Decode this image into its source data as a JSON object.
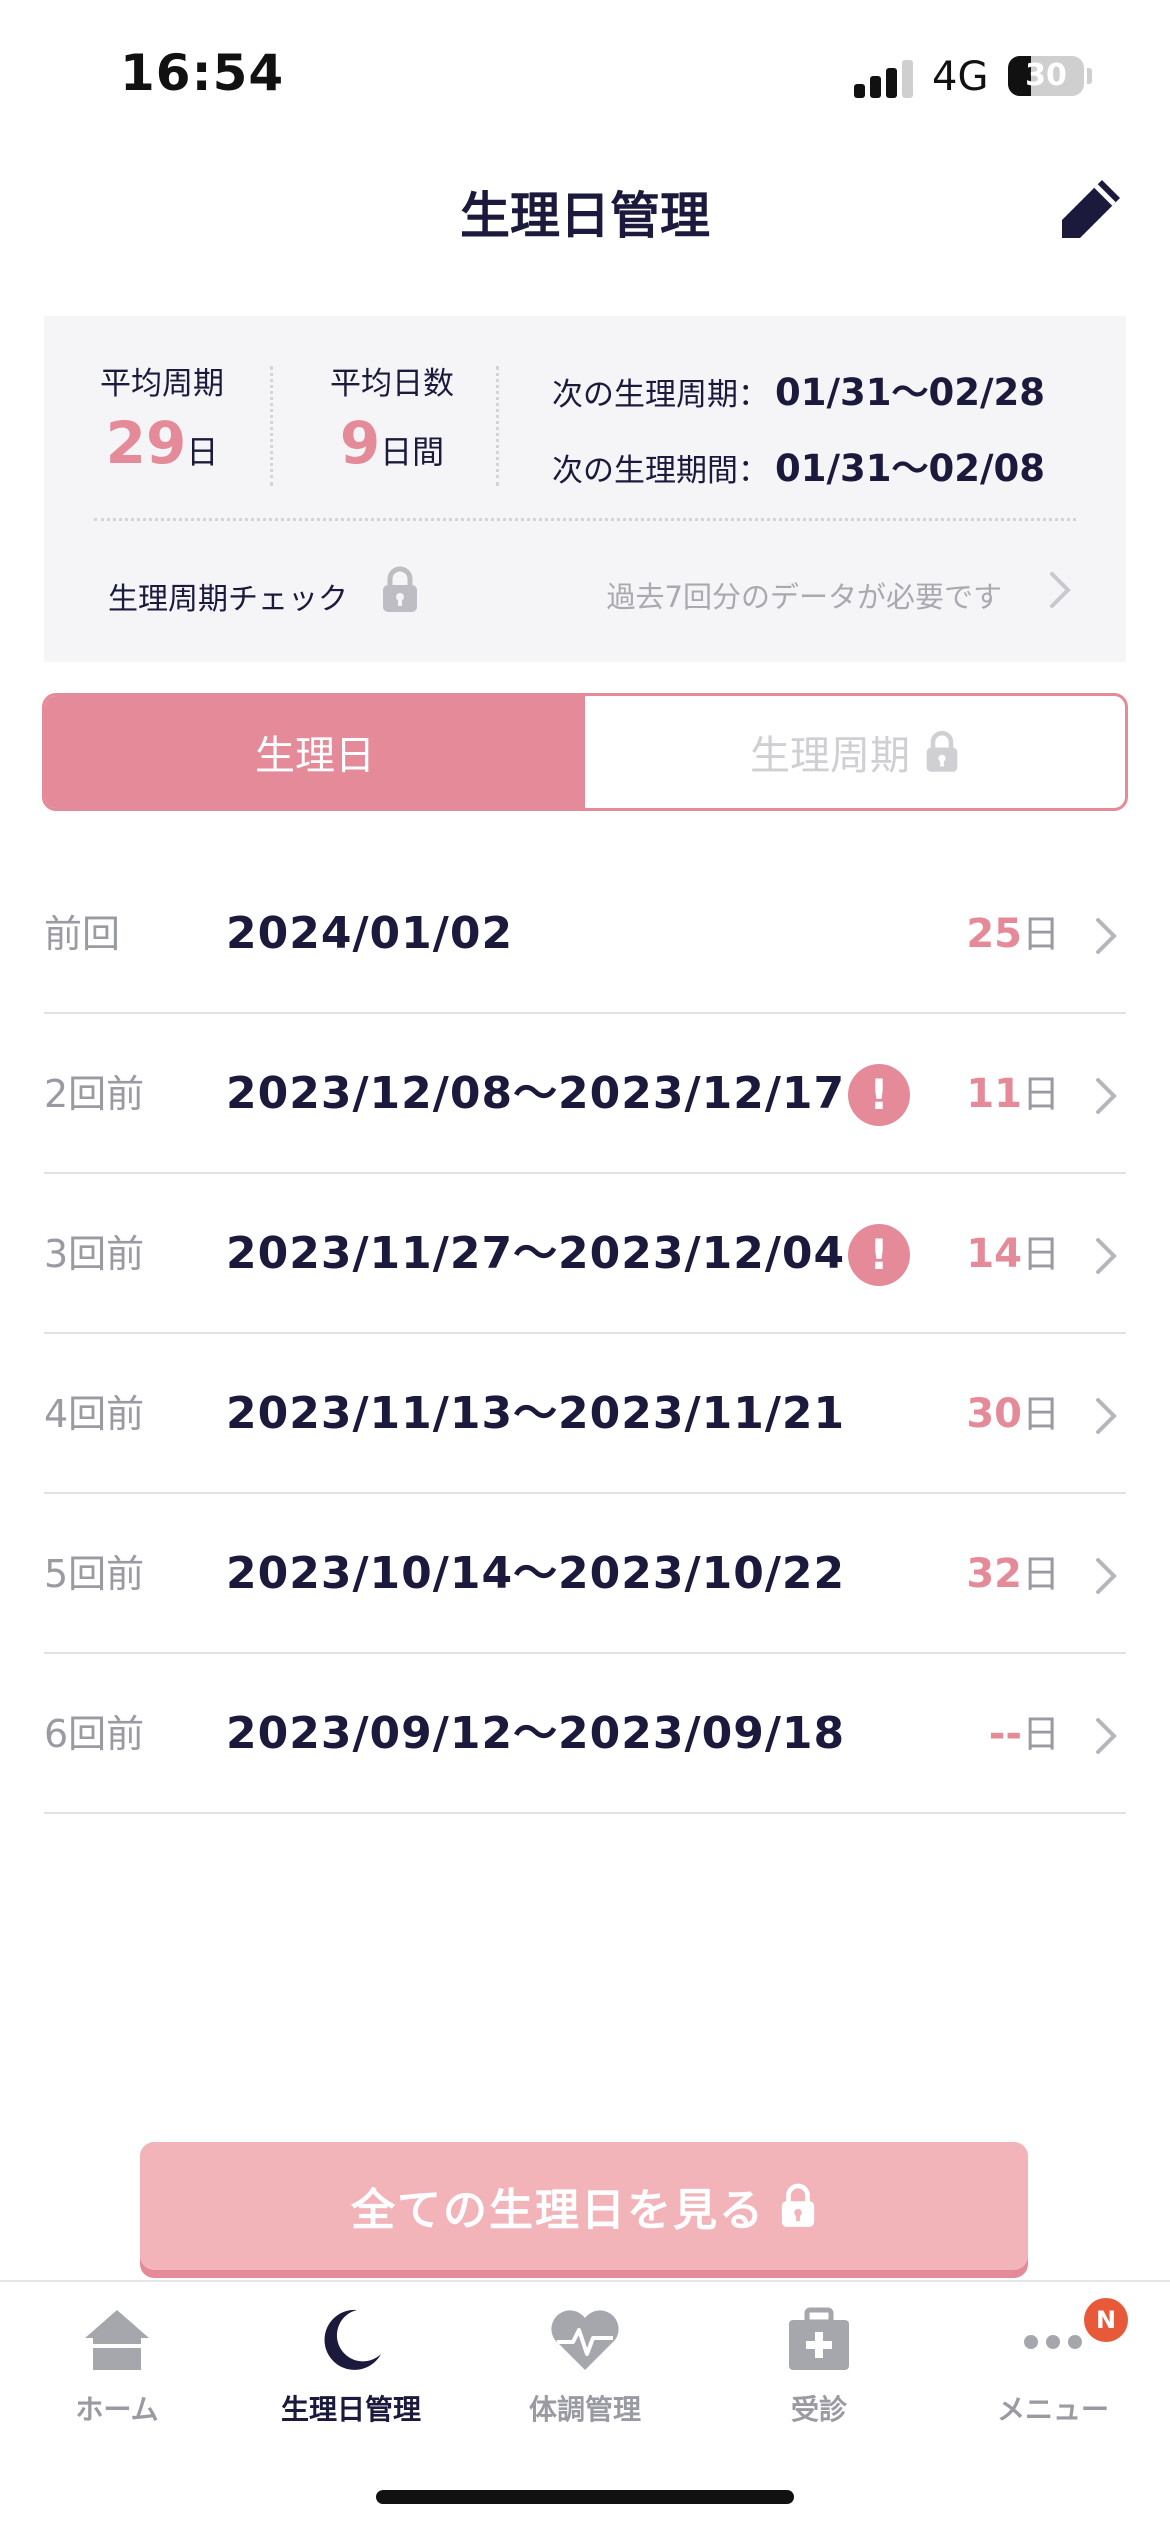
{
  "status_bar": {
    "time": "16:54",
    "network": "4G",
    "battery": "30",
    "battery_level_percent": 30
  },
  "header": {
    "title": "生理日管理",
    "edit_icon": "pencil-icon"
  },
  "summary": {
    "avg_cycle": {
      "label": "平均周期",
      "value": "29",
      "unit": "日"
    },
    "avg_days": {
      "label": "平均日数",
      "value": "9",
      "unit": "日間"
    },
    "next_cycle": {
      "label": "次の生理周期：",
      "value": "01/31〜02/28"
    },
    "next_period": {
      "label": "次の生理期間：",
      "value": "01/31〜02/08"
    },
    "cycle_check": {
      "label": "生理周期チェック",
      "message": "過去7回分のデータが必要です",
      "locked": true
    }
  },
  "tabs": {
    "period": "生理日",
    "cycle": "生理周期",
    "cycle_locked": true
  },
  "history": [
    {
      "label": "前回",
      "date": "2024/01/02",
      "days": "25",
      "unit": "日",
      "alert": false
    },
    {
      "label": "2回前",
      "date": "2023/12/08〜2023/12/17",
      "days": "11",
      "unit": "日",
      "alert": true
    },
    {
      "label": "3回前",
      "date": "2023/11/27〜2023/12/04",
      "days": "14",
      "unit": "日",
      "alert": true
    },
    {
      "label": "4回前",
      "date": "2023/11/13〜2023/11/21",
      "days": "30",
      "unit": "日",
      "alert": false
    },
    {
      "label": "5回前",
      "date": "2023/10/14〜2023/10/22",
      "days": "32",
      "unit": "日",
      "alert": false
    },
    {
      "label": "6回前",
      "date": "2023/09/12〜2023/09/18",
      "days": "--",
      "unit": "日",
      "alert": false
    }
  ],
  "cta": {
    "all_periods": "全ての生理日を見る"
  },
  "tab_bar": {
    "items": [
      {
        "label": "ホーム",
        "icon": "home-icon",
        "active": false
      },
      {
        "label": "生理日管理",
        "icon": "moon-icon",
        "active": true
      },
      {
        "label": "体調管理",
        "icon": "heart-pulse-icon",
        "active": false
      },
      {
        "label": "受診",
        "icon": "medical-kit-icon",
        "active": false
      },
      {
        "label": "メニュー",
        "icon": "more-dots-icon",
        "active": false
      }
    ],
    "menu_badge": "N"
  },
  "colors": {
    "accent": "#e48a98",
    "cta_bg": "#f2b3b9",
    "text_dark": "#1b1a3d",
    "text_muted": "#9a9aa2",
    "badge": "#e8593a"
  }
}
